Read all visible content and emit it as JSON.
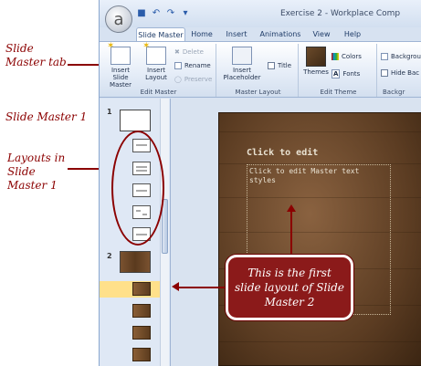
{
  "window": {
    "title": "Exercise 2 - Workplace Comp",
    "office_button_glyph": "a"
  },
  "tabs": [
    {
      "label": "Slide Master",
      "active": true
    },
    {
      "label": "Home",
      "active": false
    },
    {
      "label": "Insert",
      "active": false
    },
    {
      "label": "Animations",
      "active": false
    },
    {
      "label": "View",
      "active": false
    },
    {
      "label": "Help",
      "active": false
    }
  ],
  "ribbon": {
    "edit_master": {
      "label": "Edit Master",
      "insert_slide_master": "Insert Slide Master",
      "insert_layout": "Insert Layout",
      "delete": "Delete",
      "rename": "Rename",
      "preserve": "Preserve"
    },
    "master_layout": {
      "label": "Master Layout",
      "insert_placeholder": "Insert Placeholder",
      "title": "Title"
    },
    "edit_theme": {
      "label": "Edit Theme",
      "themes": "Themes",
      "colors": "Colors",
      "fonts": "Fonts"
    },
    "background": {
      "label": "Backgr",
      "background_styles": "Backgrou",
      "hide_background": "Hide Bac"
    }
  },
  "slide_pane": {
    "master1_number": "1",
    "master2_number": "2"
  },
  "slide": {
    "title_placeholder": "Click to edit",
    "body_placeholder": "Click to edit Master text styles"
  },
  "annotations": {
    "slide_master_tab": "Slide Master tab",
    "slide_master_1": "Slide Master 1",
    "layouts": "Layouts in Slide Master 1",
    "callout": "This is the first slide layout of Slide Master 2"
  },
  "colors": {
    "annotation": "#8b0000",
    "ribbon_bg": "#e4ecf7",
    "selection": "#ffe08a"
  }
}
